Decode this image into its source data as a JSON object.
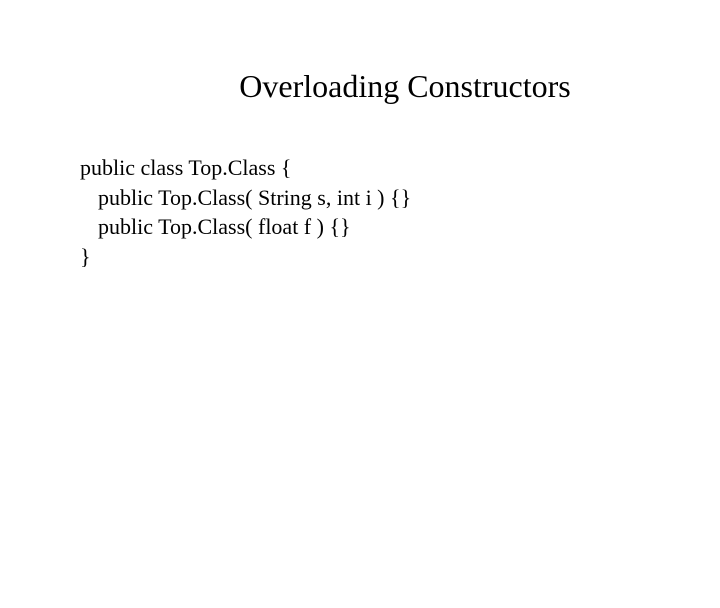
{
  "title": "Overloading Constructors",
  "code": {
    "line1": "public class Top.Class {",
    "line2": "public Top.Class( String s, int i ) {}",
    "line3": "public Top.Class( float f ) {}",
    "line4": "}"
  }
}
